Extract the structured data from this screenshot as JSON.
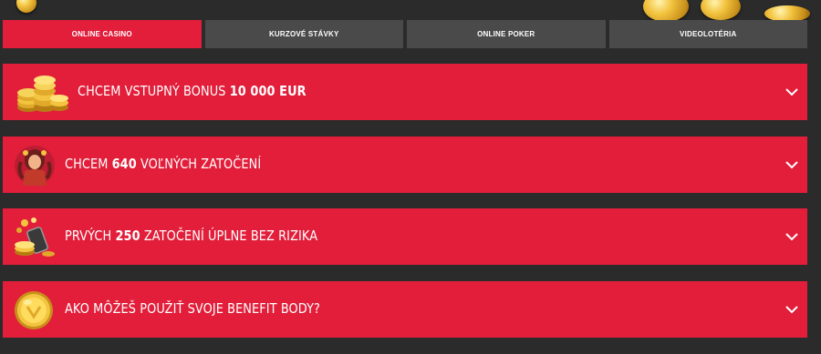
{
  "colors": {
    "page_bg": "#2b2b2b",
    "accent": "#e21e3a",
    "tab_inactive": "#4a4a4a",
    "text": "#ffffff"
  },
  "tabs": [
    {
      "label": "ONLINE CASINO",
      "active": true
    },
    {
      "label": "KURZOVÉ STÁVKY",
      "active": false
    },
    {
      "label": "ONLINE POKER",
      "active": false
    },
    {
      "label": "VIDEOLOTÉRIA",
      "active": false
    }
  ],
  "accordions": [
    {
      "icon": "coin-stack-icon",
      "prefix": "CHCEM VSTUPNÝ BONUS ",
      "bold": "10 000 EUR",
      "suffix": ""
    },
    {
      "icon": "character-avatar-icon",
      "prefix": "CHCEM ",
      "bold": "640",
      "suffix": " VOĽNÝCH ZATOČENÍ"
    },
    {
      "icon": "phone-coins-icon",
      "prefix": "PRVÝCH ",
      "bold": "250",
      "suffix": " ZATOČENÍ ÚPLNE BEZ RIZIKA"
    },
    {
      "icon": "gold-coin-icon",
      "prefix": "AKO MÔŽEŠ POUŽIŤ SVOJE BENEFIT BODY?",
      "bold": "",
      "suffix": ""
    }
  ],
  "chevron_icon": "chevron-down-icon"
}
